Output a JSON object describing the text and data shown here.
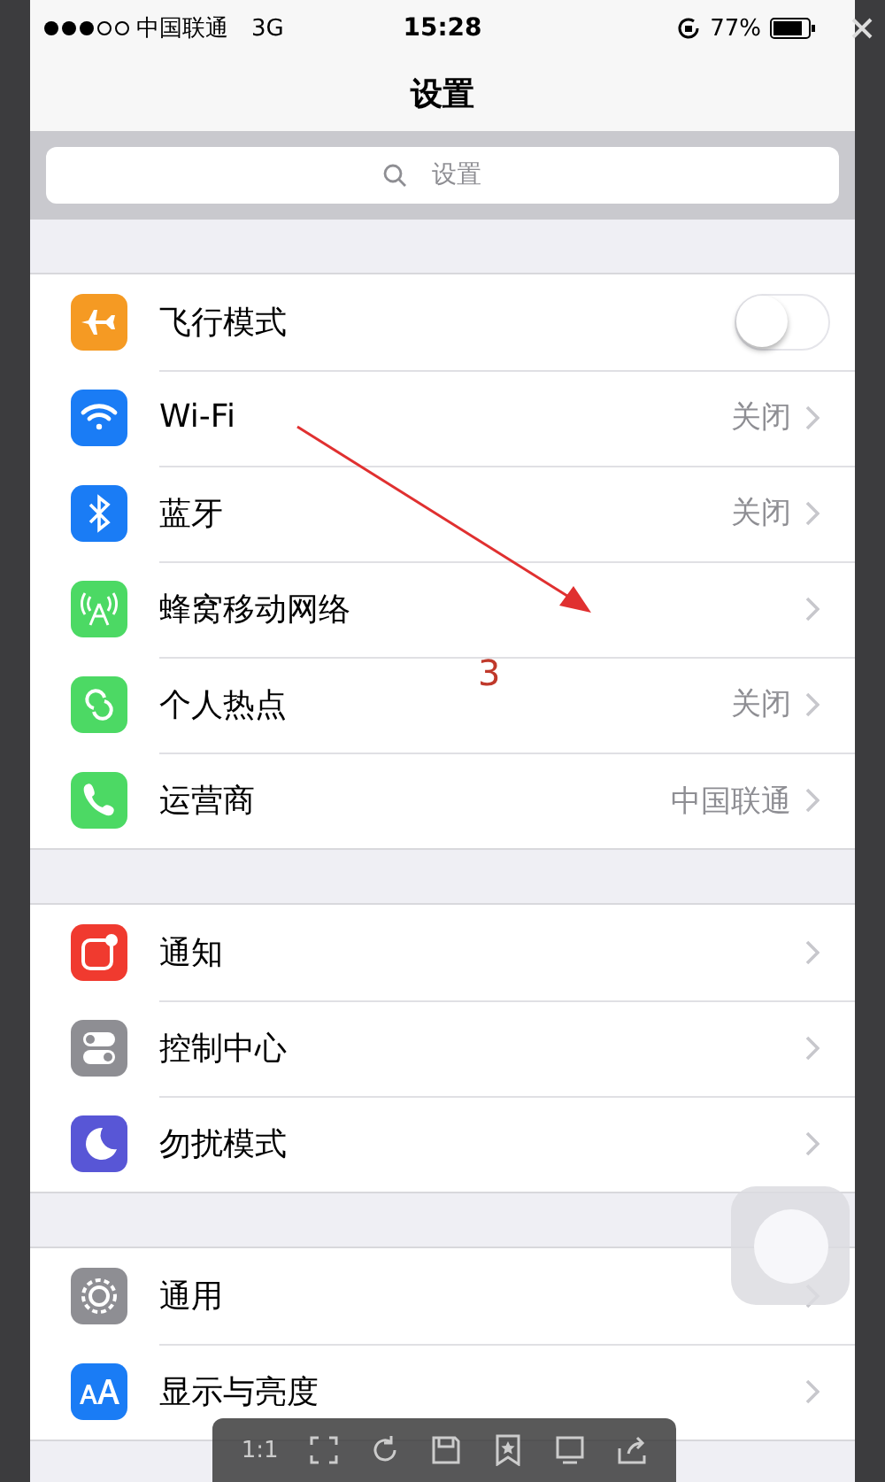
{
  "status_bar": {
    "carrier": "中国联通",
    "network": "3G",
    "time": "15:28",
    "battery": "77%"
  },
  "nav": {
    "title": "设置"
  },
  "search": {
    "placeholder": "设置"
  },
  "groups": [
    [
      {
        "kind": "switch",
        "label": "飞行模式",
        "color": "#f59a23",
        "on": false
      },
      {
        "kind": "link",
        "label": "Wi-Fi",
        "value": "关闭",
        "color": "#1a7cf5"
      },
      {
        "kind": "link",
        "label": "蓝牙",
        "value": "关闭",
        "color": "#1a7cf5"
      },
      {
        "kind": "link",
        "label": "蜂窝移动网络",
        "color": "#4cd964"
      },
      {
        "kind": "link",
        "label": "个人热点",
        "value": "关闭",
        "color": "#4cd964"
      },
      {
        "kind": "link",
        "label": "运营商",
        "value": "中国联通",
        "color": "#4cd964"
      }
    ],
    [
      {
        "kind": "link",
        "label": "通知",
        "color": "#f03a2f"
      },
      {
        "kind": "link",
        "label": "控制中心",
        "color": "#8e8e93"
      },
      {
        "kind": "link",
        "label": "勿扰模式",
        "color": "#5856d6"
      }
    ],
    [
      {
        "kind": "link",
        "label": "通用",
        "color": "#8e8e93"
      },
      {
        "kind": "link",
        "label": "显示与亮度",
        "color": "#1a7cf5"
      }
    ]
  ],
  "annotation": {
    "label": "3"
  },
  "viewer_toolbar": {
    "zoom_label": "1:1"
  }
}
